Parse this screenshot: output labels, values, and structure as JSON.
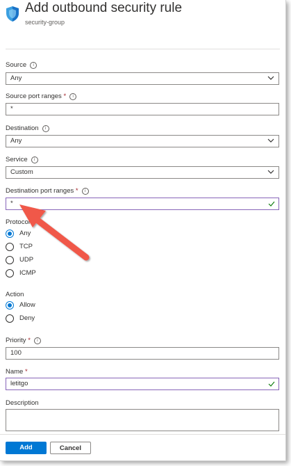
{
  "header": {
    "title": "Add outbound security rule",
    "subtitle": "security-group"
  },
  "form": {
    "source": {
      "label": "Source",
      "value": "Any"
    },
    "source_port_ranges": {
      "label": "Source port ranges",
      "required": "*",
      "value": "*"
    },
    "destination": {
      "label": "Destination",
      "value": "Any"
    },
    "service": {
      "label": "Service",
      "value": "Custom"
    },
    "destination_port_ranges": {
      "label": "Destination port ranges",
      "required": "*",
      "value": "*"
    },
    "protocol": {
      "label": "Protocol",
      "options": [
        "Any",
        "TCP",
        "UDP",
        "ICMP"
      ],
      "selected": "Any"
    },
    "action": {
      "label": "Action",
      "options": [
        "Allow",
        "Deny"
      ],
      "selected": "Allow"
    },
    "priority": {
      "label": "Priority",
      "required": "*",
      "value": "100"
    },
    "name": {
      "label": "Name",
      "required": "*",
      "value": "letitgo"
    },
    "description": {
      "label": "Description",
      "value": ""
    }
  },
  "footer": {
    "add_label": "Add",
    "cancel_label": "Cancel"
  },
  "colors": {
    "accent": "#0078d4",
    "focus_border": "#8764b8",
    "valid_check": "#107c10",
    "annotation_arrow": "#f0584a"
  },
  "icons": {
    "header": "shield-icon",
    "dropdown": "chevron-down-icon",
    "valid": "checkmark-icon",
    "info": "info-icon"
  }
}
